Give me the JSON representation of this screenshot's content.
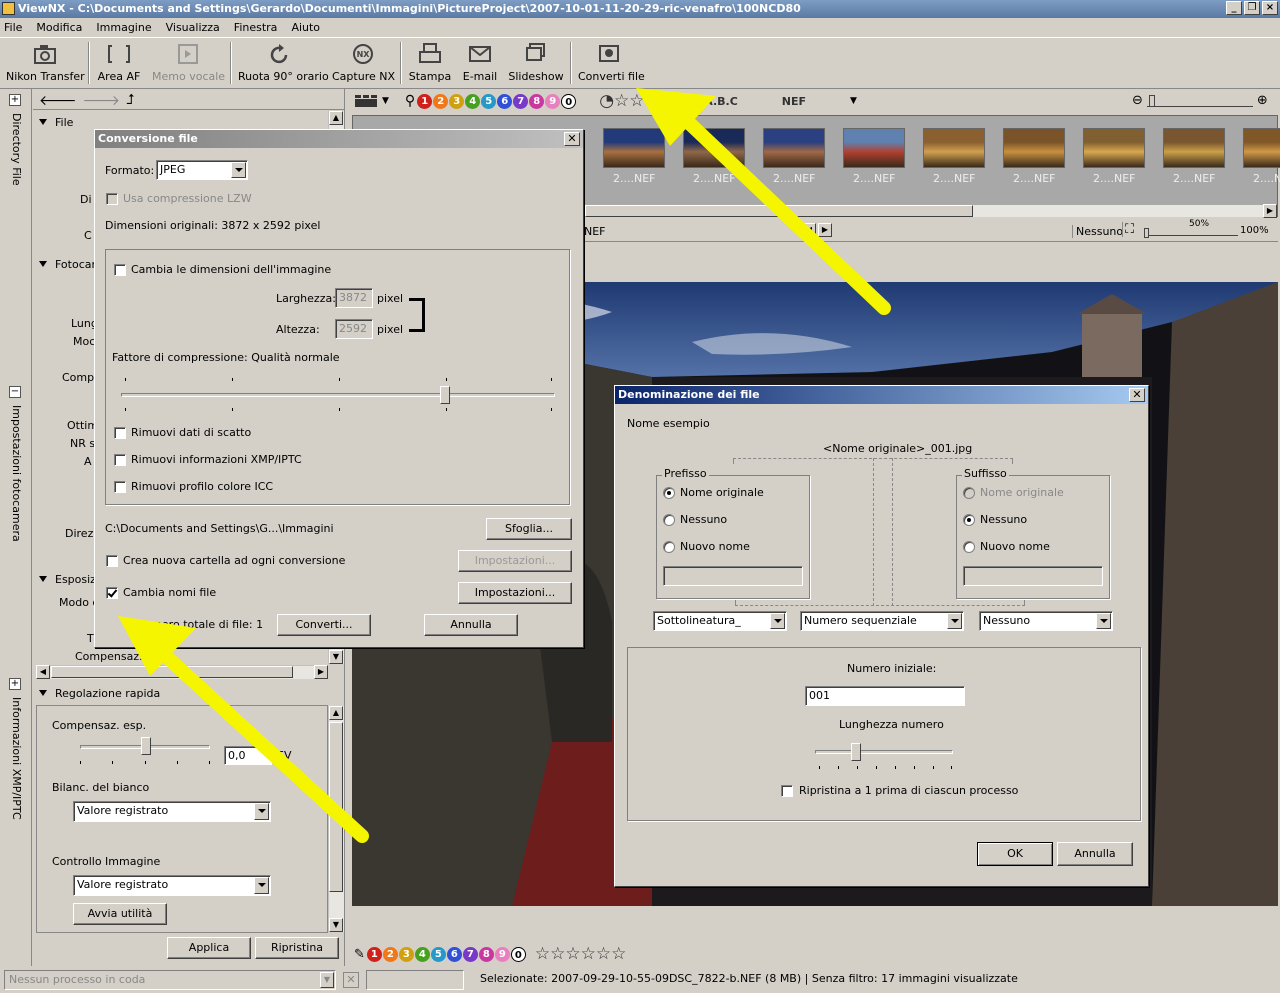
{
  "window": {
    "title": "ViewNX - C:\\Documents and Settings\\Gerardo\\Documenti\\Immagini\\PictureProject\\2007-10-01-11-20-29-ric-venafro\\100NCD80"
  },
  "menu": [
    "File",
    "Modifica",
    "Immagine",
    "Visualizza",
    "Finestra",
    "Aiuto"
  ],
  "toolbar": {
    "nikon_transfer": "Nikon Transfer",
    "area_af": "Area AF",
    "memo_vocale": "Memo vocale",
    "ruota": "Ruota 90° orario",
    "capture_nx": "Capture NX",
    "stampa": "Stampa",
    "email": "E-mail",
    "slideshow": "Slideshow",
    "converti": "Converti file"
  },
  "side_tabs": {
    "directory": "Directory File",
    "impostazioni": "Impostazioni fotocamera",
    "xmp": "Informazioni XMP/IPTC"
  },
  "left_panel": {
    "file_section": "File",
    "di": "Di",
    "c": "C",
    "fotocar": "Fotocar",
    "lung": "Lung",
    "moc": "Moc",
    "comp": "Comp.",
    "ottim": "Ottim",
    "nr": "NR s",
    "a": "A",
    "direz": "Direzi",
    "esposiz": "Esposiz",
    "modo": "Modo d",
    "t": "T",
    "compensaz": "Compensaz. esp."
  },
  "quick_adjust": {
    "title": "Regolazione rapida",
    "comp_label": "Compensaz. esp.",
    "comp_value": "0,0",
    "ev": "EV",
    "wb_label": "Bilanc. del bianco",
    "wb_value": "Valore registrato",
    "ctrl_label": "Controllo Immagine",
    "ctrl_value": "Valore registrato",
    "avvia": "Avvia utilità",
    "applica": "Applica",
    "ripristina": "Ripristina"
  },
  "filter_bar": {
    "labels": [
      "1",
      "2",
      "3",
      "4",
      "5",
      "6",
      "7",
      "8",
      "9",
      "0"
    ],
    "abc": "A.B.C",
    "nef": "NEF"
  },
  "label_colors": [
    "#d0201a",
    "#f07818",
    "#d0a010",
    "#48a020",
    "#2898c8",
    "#3050d8",
    "#7838c8",
    "#c838a0",
    "#e880c0"
  ],
  "thumbnails": [
    "2....NEF",
    "2....NEF",
    "2....NEF",
    "2....NEF",
    "2....NEF",
    "2....NEF",
    "2....NEF",
    "2....NEF",
    "2....N"
  ],
  "viewer_bar": {
    "file": "NEF",
    "nessuno": "Nessuno",
    "zoom_mid": "50%",
    "zoom_max": "100%"
  },
  "dialog_conv": {
    "title": "Conversione file",
    "formato_label": "Formato:",
    "formato": "JPEG",
    "lzw": "Usa compressione LZW",
    "dimensioni": "Dimensioni originali: 3872 x 2592 pixel",
    "cambia_dim": "Cambia le dimensioni dell'immagine",
    "larghezza": "Larghezza:",
    "larg_val": "3872",
    "altezza": "Altezza:",
    "alt_val": "2592",
    "pixel": "pixel",
    "fattore": "Fattore di compressione: Qualità normale",
    "rimuovi_scatto": "Rimuovi dati di scatto",
    "rimuovi_xmp": "Rimuovi informazioni XMP/IPTC",
    "rimuovi_icc": "Rimuovi profilo colore ICC",
    "path": "C:\\Documents and Settings\\G...\\Immagini",
    "sfoglia": "Sfoglia...",
    "nuova_cartella": "Crea nuova cartella ad ogni conversione",
    "impostazioni": "Impostazioni...",
    "cambia_nomi": "Cambia nomi file",
    "numero_totale": "Numero totale di file: 1",
    "converti": "Converti...",
    "annulla": "Annulla"
  },
  "dialog_name": {
    "title": "Denominazione dei file",
    "nome_esempio": "Nome esempio",
    "example": "<Nome originale>_001.jpg",
    "prefisso": "Prefisso",
    "suffisso": "Suffisso",
    "nome_originale": "Nome originale",
    "nessuno": "Nessuno",
    "nuovo_nome": "Nuovo nome",
    "sep1": "Sottolineatura_",
    "sep2": "Numero sequenziale",
    "sep3": "Nessuno",
    "numero_iniziale": "Numero iniziale:",
    "num_val": "001",
    "lunghezza": "Lunghezza numero",
    "ripristina": "Ripristina a 1 prima di ciascun processo",
    "ok": "OK",
    "annulla": "Annulla"
  },
  "status": {
    "queue": "Nessun processo in coda",
    "info": "Selezionate: 2007-09-29-10-55-09DSC_7822-b.NEF (8 MB) | Senza filtro: 17 immagini visualizzate"
  }
}
